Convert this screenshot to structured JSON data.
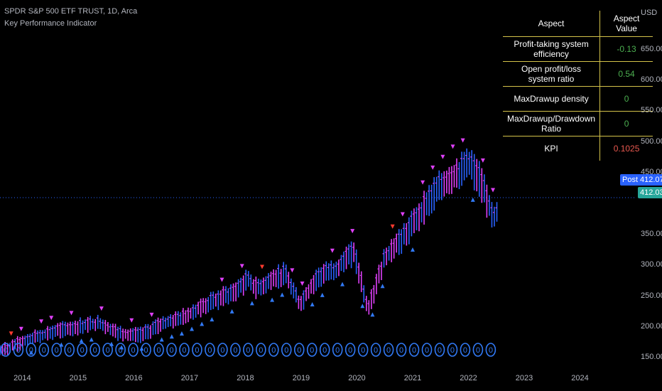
{
  "header": {
    "title": "SPDR S&P 500 ETF TRUST, 1D, Arca",
    "indicator": "Key Performance Indicator"
  },
  "table": {
    "headers": [
      "Aspect",
      "Aspect Value"
    ],
    "rows": [
      {
        "aspect": "Profit-taking system efficiency",
        "value": "-0.13"
      },
      {
        "aspect": "Open profit/loss system ratio",
        "value": "0.54"
      },
      {
        "aspect": "MaxDrawup density",
        "value": "0"
      },
      {
        "aspect": "MaxDrawup/Drawdown Ratio",
        "value": "0"
      },
      {
        "aspect": "KPI",
        "value": "0.1025"
      }
    ]
  },
  "price_axis": {
    "currency": "USD",
    "ticks": [
      "650.00",
      "600.00",
      "550.00",
      "500.00",
      "450.00",
      "350.00",
      "300.00",
      "250.00",
      "200.00",
      "150.00"
    ],
    "post_label": "Post",
    "post_price": "412.07",
    "last_price": "412.03"
  },
  "colors": {
    "bull": "#2962ff",
    "bear": "#e040fb",
    "marker": "#3179f5",
    "down_arrow": "#ff3b30",
    "price_line": "#2962ff",
    "last_price_badge": "#26a69a",
    "table_border": "#d4c24a"
  },
  "chart_data": {
    "type": "line",
    "symbol": "SPY",
    "interval": "1D",
    "x_ticks": [
      "2014",
      "2015",
      "2016",
      "2017",
      "2018",
      "2019",
      "2020",
      "2021",
      "2022",
      "2023",
      "2024"
    ],
    "ylim": [
      150,
      700
    ],
    "last_price": 412.03,
    "series": [
      {
        "x": [
          2013.6,
          2014.0,
          2014.5,
          2015.0,
          2015.4,
          2015.7,
          2016.1,
          2016.5,
          2016.9,
          2017.3,
          2017.8,
          2018.05,
          2018.2,
          2018.7,
          2018.98,
          2019.3,
          2019.6,
          2019.95,
          2020.2,
          2020.5,
          2020.9,
          2021.3,
          2021.7,
          2021.9,
          2022.0,
          2022.2,
          2022.45,
          2022.55
        ],
        "y": [
          165,
          180,
          195,
          205,
          210,
          195,
          190,
          208,
          220,
          240,
          260,
          280,
          265,
          290,
          240,
          285,
          295,
          325,
          230,
          315,
          355,
          410,
          445,
          455,
          470,
          440,
          380,
          395
        ]
      }
    ],
    "marker_row": {
      "label": "0",
      "x_start": 2013.7,
      "x_end": 2022.4,
      "count": 39
    }
  }
}
